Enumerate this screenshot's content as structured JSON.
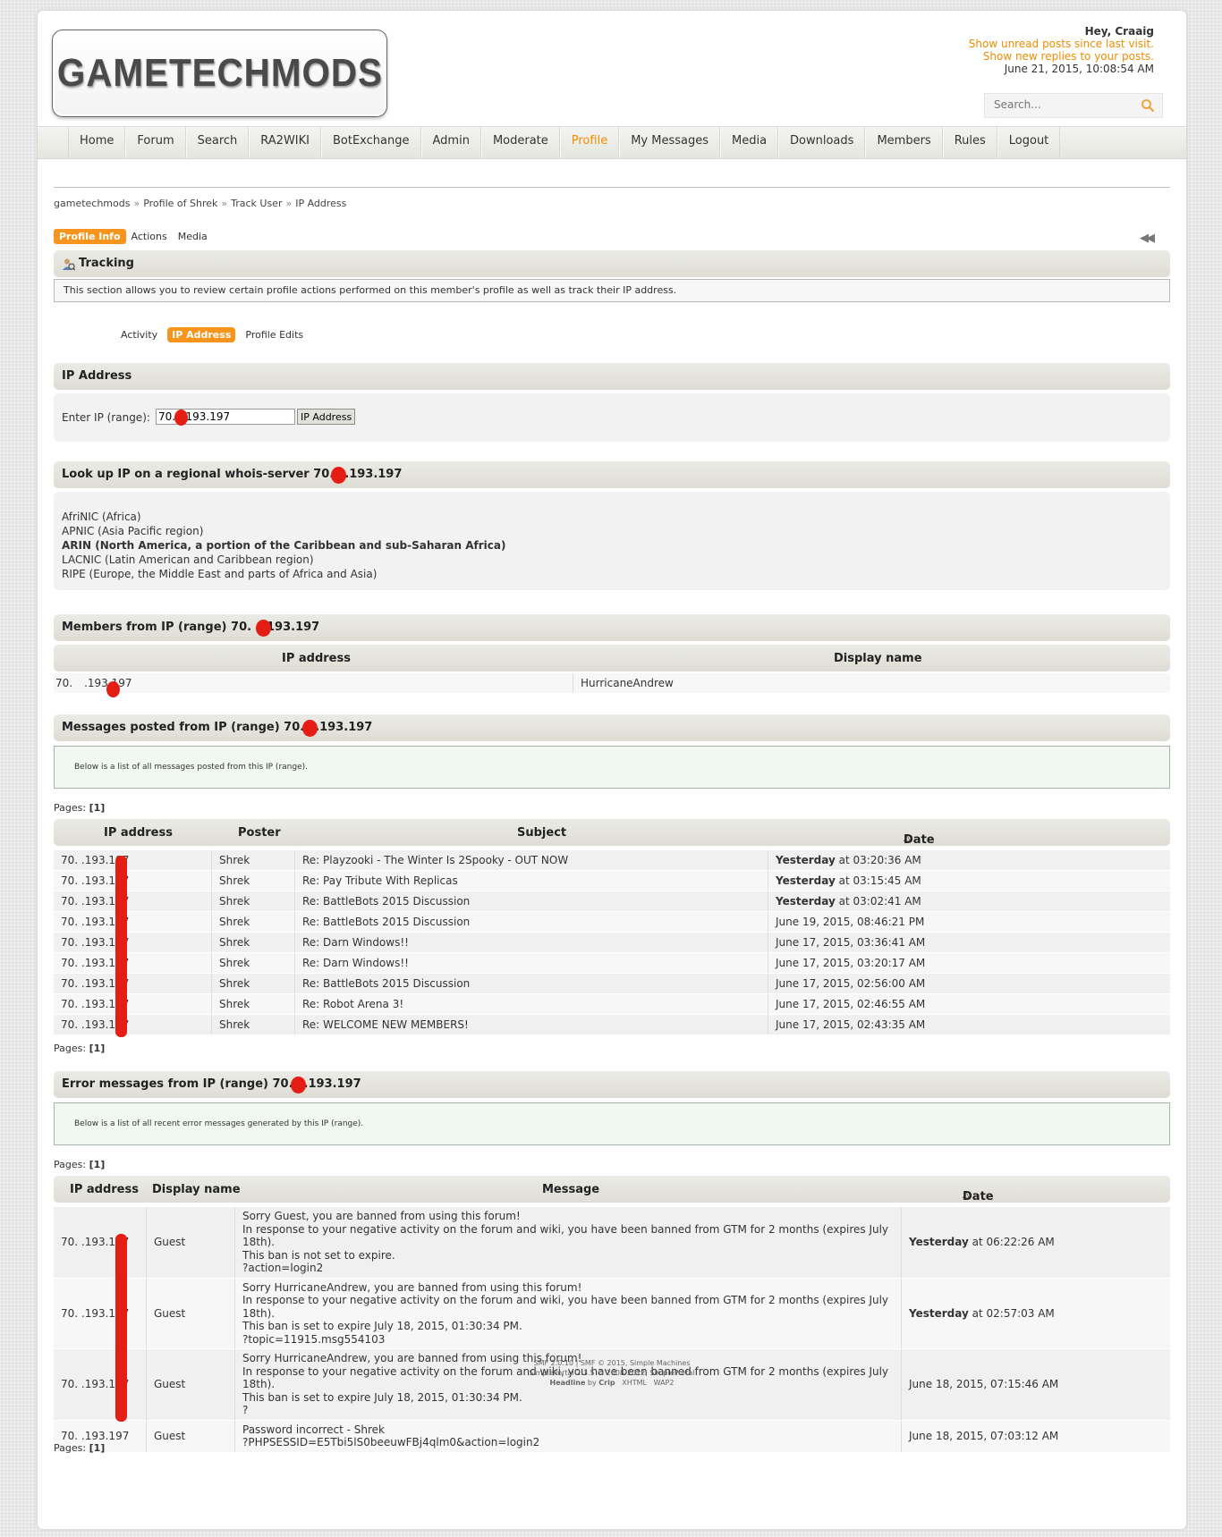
{
  "site": {
    "logo_text": "GAMETECHMODS"
  },
  "user": {
    "greeting": "Hey, Craaig",
    "unread_link": "Show unread posts since last visit.",
    "replies_link": "Show new replies to your posts.",
    "datetime": "June 21, 2015, 10:08:54 AM"
  },
  "search": {
    "placeholder": "Search..."
  },
  "menu": [
    "Home",
    "Forum",
    "Search",
    "RA2WIKI",
    "BotExchange",
    "Admin",
    "Moderate",
    "Profile",
    "My Messages",
    "Media",
    "Downloads",
    "Members",
    "Rules",
    "Logout"
  ],
  "menu_active": "Profile",
  "breadcrumb": [
    "gametechmods",
    "Profile of Shrek",
    "Track User",
    "IP Address"
  ],
  "profile_tabs": [
    "Profile Info",
    "Actions",
    "Media"
  ],
  "tracking": {
    "title": "Tracking",
    "description": "This section allows you to review certain profile actions performed on this member's profile as well as track their IP address.",
    "tabs": [
      "Activity",
      "IP Address",
      "Profile Edits"
    ]
  },
  "ip_section": {
    "title": "IP Address",
    "label": "Enter IP (range):",
    "value": "70.  .193.197",
    "button": "IP Address"
  },
  "whois": {
    "title": "Look up IP on a regional whois-server 70.",
    "title_suffix": ".193.197",
    "items": [
      {
        "text": "AfriNIC (Africa)",
        "bold": false
      },
      {
        "text": "APNIC (Asia Pacific region)",
        "bold": false
      },
      {
        "text": "ARIN (North America, a portion of the Caribbean and sub-Saharan Africa)",
        "bold": true
      },
      {
        "text": "LACNIC (Latin American and Caribbean region)",
        "bold": false
      },
      {
        "text": "RIPE (Europe, the Middle East and parts of Africa and Asia)",
        "bold": false
      }
    ]
  },
  "members": {
    "title": "Members from IP (range) 70.",
    "title_suffix": ".193.197",
    "col_ip": "IP address",
    "col_name": "Display name",
    "row_ip_prefix": "70.",
    "row_ip_suffix": ".193.197",
    "row_name": "HurricaneAndrew"
  },
  "messages": {
    "title": "Messages posted from IP (range) 70.",
    "title_suffix": ".193.197",
    "description": "Below is a list of all messages posted from this IP (range).",
    "pages_label": "Pages:",
    "pages_value": "[1]",
    "headers": [
      "IP address",
      "Poster",
      "Subject",
      "Date"
    ],
    "rows": [
      {
        "ip": "70.  .193.197",
        "poster": "Shrek",
        "subject": "Re: Playzooki - The Winter Is 2Spooky - OUT NOW",
        "date_bold": "Yesterday",
        "date": " at 03:20:36 AM"
      },
      {
        "ip": "70.  .193.197",
        "poster": "Shrek",
        "subject": "Re: Pay Tribute With Replicas",
        "date_bold": "Yesterday",
        "date": " at 03:15:45 AM"
      },
      {
        "ip": "70.  .193.197",
        "poster": "Shrek",
        "subject": "Re: BattleBots 2015 Discussion",
        "date_bold": "Yesterday",
        "date": " at 03:02:41 AM"
      },
      {
        "ip": "70.  .193.197",
        "poster": "Shrek",
        "subject": "Re: BattleBots 2015 Discussion",
        "date_bold": "",
        "date": "June 19, 2015, 08:46:21 PM"
      },
      {
        "ip": "70.  .193.197",
        "poster": "Shrek",
        "subject": "Re: Darn Windows!!",
        "date_bold": "",
        "date": "June 17, 2015, 03:36:41 AM"
      },
      {
        "ip": "70.  .193.197",
        "poster": "Shrek",
        "subject": "Re: Darn Windows!!",
        "date_bold": "",
        "date": "June 17, 2015, 03:20:17 AM"
      },
      {
        "ip": "70.  .193.197",
        "poster": "Shrek",
        "subject": "Re: BattleBots 2015 Discussion",
        "date_bold": "",
        "date": "June 17, 2015, 02:56:00 AM"
      },
      {
        "ip": "70.  .193.197",
        "poster": "Shrek",
        "subject": "Re: Robot Arena 3!",
        "date_bold": "",
        "date": "June 17, 2015, 02:46:55 AM"
      },
      {
        "ip": "70.  .193.197",
        "poster": "Shrek",
        "subject": "Re: WELCOME NEW MEMBERS!",
        "date_bold": "",
        "date": "June 17, 2015, 02:43:35 AM"
      }
    ]
  },
  "errors": {
    "title": "Error messages from IP (range) 70.",
    "title_suffix": ".193.197",
    "description": "Below is a list of all recent error messages generated by this IP (range).",
    "pages_label": "Pages:",
    "pages_value": "[1]",
    "headers": [
      "IP address",
      "Display name",
      "Message",
      "Date"
    ],
    "rows": [
      {
        "ip": "70.  .193.197",
        "name": "Guest",
        "lines": [
          "Sorry Guest, you are banned from using this forum!",
          "In response to your negative activity on the forum and wiki, you have been banned from GTM for 2 months (expires July 18th).",
          "This ban is not set to expire.",
          "?action=login2"
        ],
        "date_bold": "Yesterday",
        "date": " at 06:22:26 AM"
      },
      {
        "ip": "70.  .193.197",
        "name": "Guest",
        "lines": [
          "Sorry HurricaneAndrew, you are banned from using this forum!",
          "In response to your negative activity on the forum and wiki, you have been banned from GTM for 2 months (expires July 18th).",
          "This ban is set to expire July 18, 2015, 01:30:34 PM.",
          "?topic=11915.msg554103"
        ],
        "date_bold": "Yesterday",
        "date": " at 02:57:03 AM"
      },
      {
        "ip": "70.  .193.197",
        "name": "Guest",
        "lines": [
          "Sorry HurricaneAndrew, you are banned from using this forum!",
          "In response to your negative activity on the forum and wiki, you have been banned from GTM for 2 months (expires July 18th).",
          "This ban is set to expire July 18, 2015, 01:30:34 PM.",
          "?"
        ],
        "date_bold": "",
        "date": "June 18, 2015, 07:15:46 AM"
      },
      {
        "ip": "70.  .193.197",
        "name": "Guest",
        "lines": [
          "Password incorrect - Shrek",
          "?PHPSESSID=E5Tbi5lS0beeuwFBj4qlm0&action=login2"
        ],
        "date_bold": "",
        "date": "June 18, 2015, 07:03:12 AM"
      }
    ]
  },
  "footer": {
    "line1": "SMF 2.0.10 | SMF © 2015, Simple Machines",
    "line2": "SimplePortal 2.3.5 © 2008-2012, SimplePortal",
    "line3_bold1": "Headline",
    "line3_mid": " by ",
    "line3_bold2": "Crip",
    "line3_links": "   XHTML   WAP2"
  },
  "colors": {
    "accent": "#f08c00",
    "tab_active": "#f7941e",
    "redaction": "#e41e14"
  }
}
